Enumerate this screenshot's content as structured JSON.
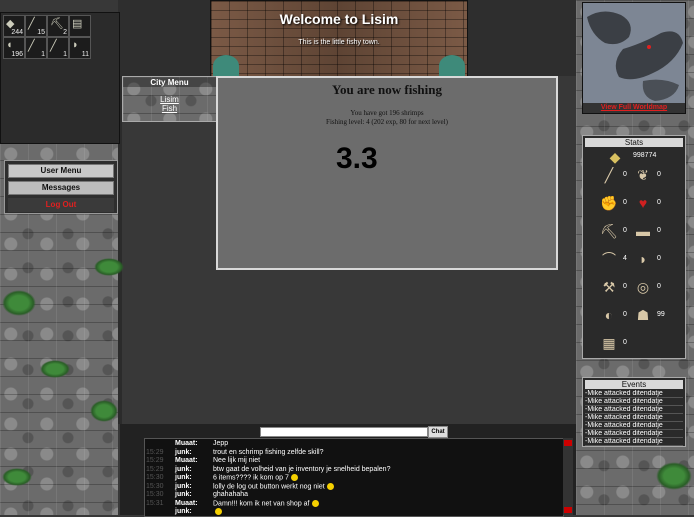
{
  "inventory": {
    "slots": [
      {
        "icon": "coins-icon",
        "glyph": "◆",
        "count": "244"
      },
      {
        "icon": "sword-icon",
        "glyph": "╱",
        "count": "15"
      },
      {
        "icon": "pickaxe-icon",
        "glyph": "⛏",
        "count": "2"
      },
      {
        "icon": "scroll-icon",
        "glyph": "▤",
        "count": ""
      },
      {
        "icon": "shrimp-icon",
        "glyph": "◖",
        "count": "196"
      },
      {
        "icon": "rod-icon",
        "glyph": "╱",
        "count": "1"
      },
      {
        "icon": "dagger-icon",
        "glyph": "╱",
        "count": "1"
      },
      {
        "icon": "fish-icon",
        "glyph": "◗",
        "count": "11"
      }
    ]
  },
  "user_menu": {
    "items": [
      "User Menu",
      "Messages",
      "Log Out"
    ]
  },
  "city_menu": {
    "title": "City Menu",
    "links": [
      "Lisim",
      "Fish"
    ]
  },
  "banner": {
    "title": "Welcome to Lisim",
    "subtitle": "This is the little fishy town."
  },
  "fishing": {
    "title": "You are now fishing",
    "line1": "You have got 196 shrimps",
    "line2": "Fishing level: 4 (202 exp, 80 for next level)",
    "timer": "3.3"
  },
  "chat": {
    "button": "Chat",
    "messages": [
      {
        "time": "",
        "name": "Muaat:",
        "text": "Jepp",
        "smile": false
      },
      {
        "time": "15:29",
        "name": "junk:",
        "text": "trout en schrimp fishing zelfde skill?",
        "smile": false
      },
      {
        "time": "15:29",
        "name": "Muaat:",
        "text": "Nee lijk mij niet",
        "smile": false
      },
      {
        "time": "15:29",
        "name": "junk:",
        "text": "btw gaat de volheid van je inventory je snelheid bepalen?",
        "smile": false
      },
      {
        "time": "15:30",
        "name": "junk:",
        "text": "6 items???? ik kom op 7",
        "smile": true
      },
      {
        "time": "15:30",
        "name": "junk:",
        "text": "lolly de log out button werkt nog niet",
        "smile": true
      },
      {
        "time": "15:30",
        "name": "junk:",
        "text": "ghahahaha",
        "smile": false
      },
      {
        "time": "15:31",
        "name": "Muaat:",
        "text": "Damn!!! kom ik net van shop af",
        "smile": true
      },
      {
        "time": "",
        "name": "junk:",
        "text": "",
        "smile": true
      }
    ]
  },
  "worldmap": {
    "link": "View Full Worldmap"
  },
  "stats": {
    "title": "Stats",
    "gold": "998774",
    "rows": [
      [
        {
          "icon": "sword-stat-icon",
          "glyph": "╱",
          "value": "0"
        },
        {
          "icon": "herb-stat-icon",
          "glyph": "❦",
          "value": "0"
        }
      ],
      [
        {
          "icon": "fist-stat-icon",
          "glyph": "✊",
          "value": "0"
        },
        {
          "icon": "heart-stat-icon",
          "glyph": "♥",
          "value": "0"
        }
      ],
      [
        {
          "icon": "pickaxe-stat-icon",
          "glyph": "⛏",
          "value": "0"
        },
        {
          "icon": "anvil-stat-icon",
          "glyph": "▬",
          "value": "0"
        }
      ],
      [
        {
          "icon": "rod-stat-icon",
          "glyph": "⌒",
          "value": "4"
        },
        {
          "icon": "fish-stat-icon",
          "glyph": "◗",
          "value": "0"
        }
      ],
      [
        {
          "icon": "axe-stat-icon",
          "glyph": "⚒",
          "value": "0"
        },
        {
          "icon": "bow-stat-icon",
          "glyph": "◎",
          "value": "0"
        }
      ],
      [
        {
          "icon": "mask-stat-icon",
          "glyph": "◐",
          "value": "0"
        },
        {
          "icon": "thief-stat-icon",
          "glyph": "☗",
          "value": "99"
        }
      ],
      [
        {
          "icon": "wood-stat-icon",
          "glyph": "▦",
          "value": "0"
        }
      ]
    ]
  },
  "events": {
    "title": "Events",
    "items": [
      "-Mike attacked ditendatje",
      "-Mike attacked ditendatje",
      "-Mike attacked ditendatje",
      "-Mike attacked ditendatje",
      "-Mike attacked ditendatje",
      "-Mike attacked ditendatje",
      "-Mike attacked ditendatje"
    ]
  },
  "colors": {
    "accent_red": "#e02020",
    "background": "#383838",
    "panel": "#6c6c6c"
  }
}
